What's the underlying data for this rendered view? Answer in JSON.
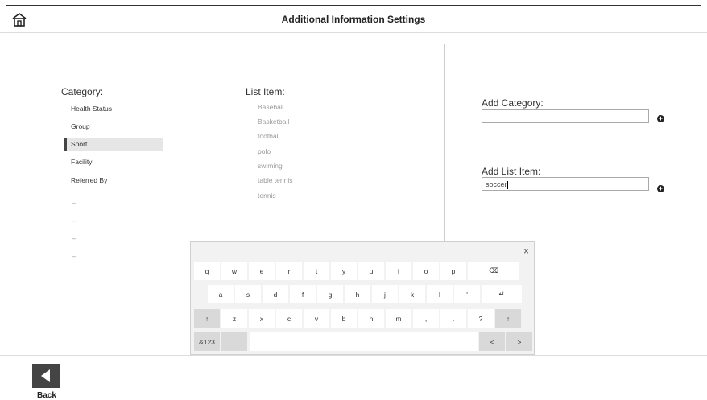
{
  "header": {
    "title": "Additional Information Settings",
    "home_icon": "home-icon"
  },
  "category": {
    "label": "Category:",
    "items": [
      "Health Status",
      "Group",
      "Sport",
      "Facility",
      "Referred By"
    ],
    "selected": "Sport",
    "placeholders": [
      "–",
      "–",
      "–",
      "–"
    ]
  },
  "list": {
    "label": "List Item:",
    "items": [
      "Baseball",
      "Basketball",
      "football",
      "polo",
      "swiming",
      "table tennis",
      "tennis"
    ]
  },
  "add_category": {
    "label": "Add Category:",
    "value": ""
  },
  "add_list_item": {
    "label": "Add List Item:",
    "value": "soccer"
  },
  "keyboard": {
    "close": "×",
    "row1": [
      "q",
      "w",
      "e",
      "r",
      "t",
      "y",
      "u",
      "i",
      "o",
      "p",
      "⌫"
    ],
    "row2": [
      "a",
      "s",
      "d",
      "f",
      "g",
      "h",
      "j",
      "k",
      "l",
      "'",
      "↵"
    ],
    "row3": [
      "↑",
      "z",
      "x",
      "c",
      "v",
      "b",
      "n",
      "m",
      ",",
      ".",
      "?",
      "↑"
    ],
    "row4": [
      "&123",
      "",
      "",
      "<",
      ">"
    ]
  },
  "footer": {
    "back_label": "Back"
  },
  "colors": {
    "accent": "#444444",
    "selected_bg": "#e6e6e6"
  }
}
